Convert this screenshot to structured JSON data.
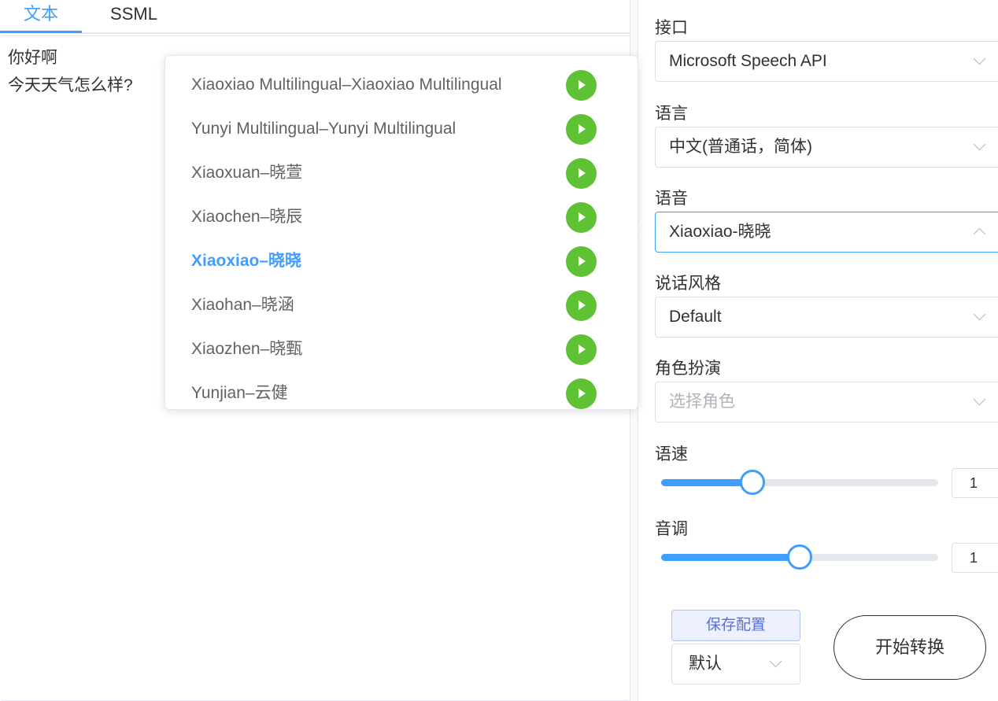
{
  "tabs": [
    {
      "label": "文本",
      "active": true
    },
    {
      "label": "SSML",
      "active": false
    }
  ],
  "editor": {
    "lines": [
      "你好啊",
      "今天天气怎么样?"
    ]
  },
  "voice_dropdown": {
    "options": [
      {
        "label": "Xiaoxiao Multilingual–Xiaoxiao Multilingual",
        "selected": false
      },
      {
        "label": "Yunyi Multilingual–Yunyi Multilingual",
        "selected": false
      },
      {
        "label": "Xiaoxuan–晓萱",
        "selected": false
      },
      {
        "label": "Xiaochen–晓辰",
        "selected": false
      },
      {
        "label": "Xiaoxiao–晓晓",
        "selected": true
      },
      {
        "label": "Xiaohan–晓涵",
        "selected": false
      },
      {
        "label": "Xiaozhen–晓甄",
        "selected": false
      },
      {
        "label": "Yunjian–云健",
        "selected": false
      }
    ],
    "play_icon": "play-icon"
  },
  "settings": {
    "api": {
      "label": "接口",
      "value": "Microsoft Speech API"
    },
    "language": {
      "label": "语言",
      "value": "中文(普通话，简体)"
    },
    "voice": {
      "label": "语音",
      "value": "Xiaoxiao-晓晓"
    },
    "style": {
      "label": "说话风格",
      "value": "Default"
    },
    "role": {
      "label": "角色扮演",
      "placeholder": "选择角色"
    },
    "rate": {
      "label": "语速",
      "value": "1",
      "slider_fraction": 0.33
    },
    "pitch": {
      "label": "音调",
      "value": "1",
      "slider_fraction": 0.5
    }
  },
  "actions": {
    "save_label": "保存配置",
    "preset_value": "默认",
    "convert_label": "开始转换"
  },
  "colors": {
    "accent": "#409eff",
    "play_green": "#5ec234",
    "save_bg": "#ecf0ff"
  }
}
